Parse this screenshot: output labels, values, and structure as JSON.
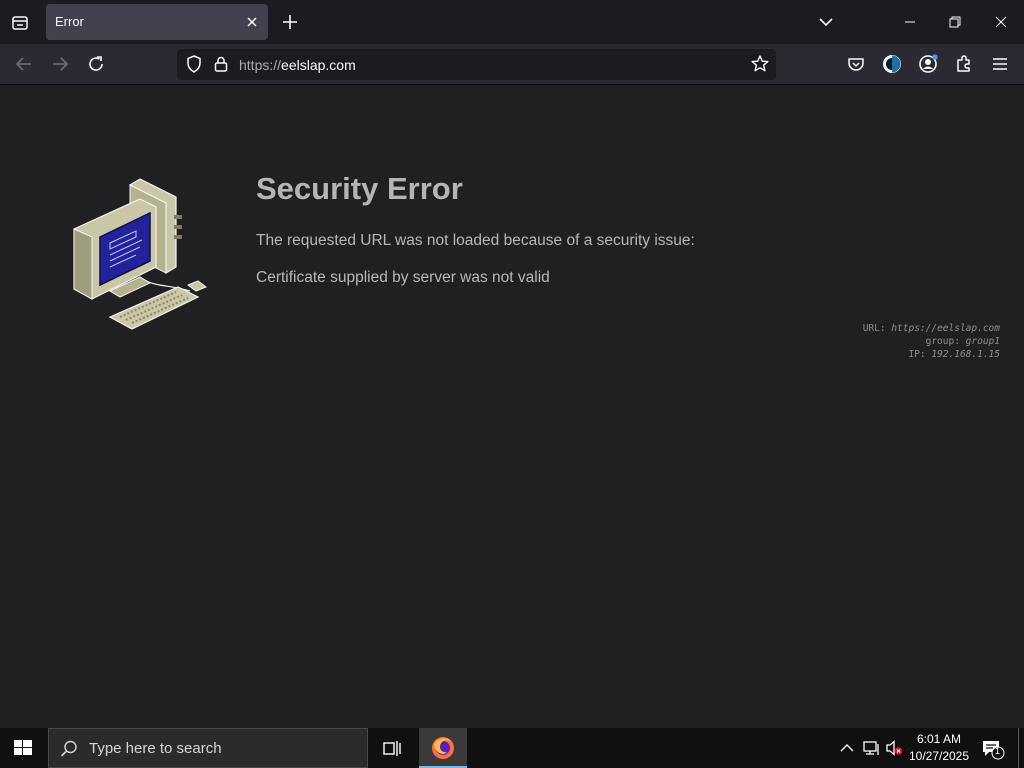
{
  "tab": {
    "title": "Error"
  },
  "urlbar": {
    "scheme": "https://",
    "host": "eelslap.com"
  },
  "page": {
    "title": "Security Error",
    "message": "The requested URL was not loaded because of a security issue:",
    "detail": "Certificate supplied by server was not valid",
    "meta": {
      "url_label": "URL:",
      "url_value": "https://eelslap.com",
      "group_label": "group:",
      "group_value": "group1",
      "ip_label": "IP:",
      "ip_value": "192.168.1.15"
    }
  },
  "taskbar": {
    "search_placeholder": "Type here to search",
    "time": "6:01 AM",
    "date": "10/27/2025",
    "notification_count": "1"
  },
  "colors": {
    "accent": "#76b9ed",
    "background": "#202023",
    "toolbar": "#2b2a33"
  }
}
